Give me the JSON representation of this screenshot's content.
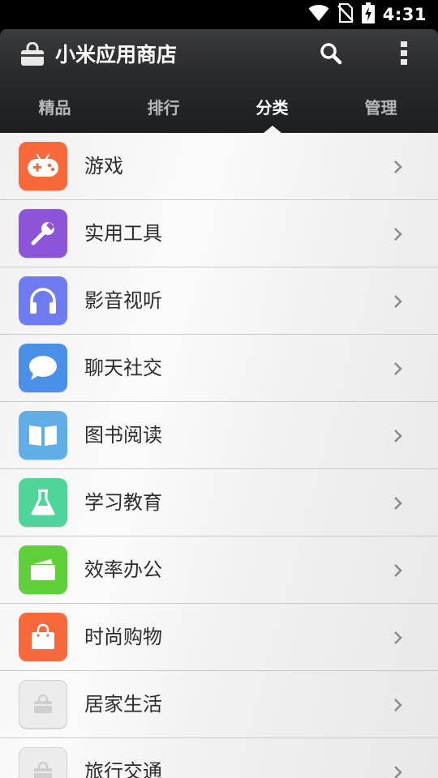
{
  "status_bar": {
    "time": "4:31",
    "icons": [
      "wifi-icon",
      "no-sim-icon",
      "battery-charging-icon"
    ]
  },
  "header": {
    "icon": "store-bag-icon",
    "title": "小米应用商店",
    "actions": [
      "search-icon",
      "overflow-menu-icon"
    ]
  },
  "tabs": [
    {
      "label": "精品",
      "active": false
    },
    {
      "label": "排行",
      "active": false
    },
    {
      "label": "分类",
      "active": true
    },
    {
      "label": "管理",
      "active": false
    }
  ],
  "categories": [
    {
      "label": "游戏",
      "icon": "gamepad-icon",
      "color": "#f7683a"
    },
    {
      "label": "实用工具",
      "icon": "wrench-icon",
      "color": "#8b54d9"
    },
    {
      "label": "影音视听",
      "icon": "headphones-icon",
      "color": "#6f7bf0"
    },
    {
      "label": "聊天社交",
      "icon": "chat-bubble-icon",
      "color": "#4a8fe8"
    },
    {
      "label": "图书阅读",
      "icon": "open-book-icon",
      "color": "#5faee8"
    },
    {
      "label": "学习教育",
      "icon": "flask-icon",
      "color": "#4fd49a"
    },
    {
      "label": "效率办公",
      "icon": "folder-icon",
      "color": "#5fcf3a"
    },
    {
      "label": "时尚购物",
      "icon": "shopping-bag-icon",
      "color": "#f7683a"
    },
    {
      "label": "居家生活",
      "icon": "placeholder-bag-icon",
      "color": "#ececec"
    },
    {
      "label": "旅行交通",
      "icon": "placeholder-bag-icon",
      "color": "#ececec"
    }
  ]
}
